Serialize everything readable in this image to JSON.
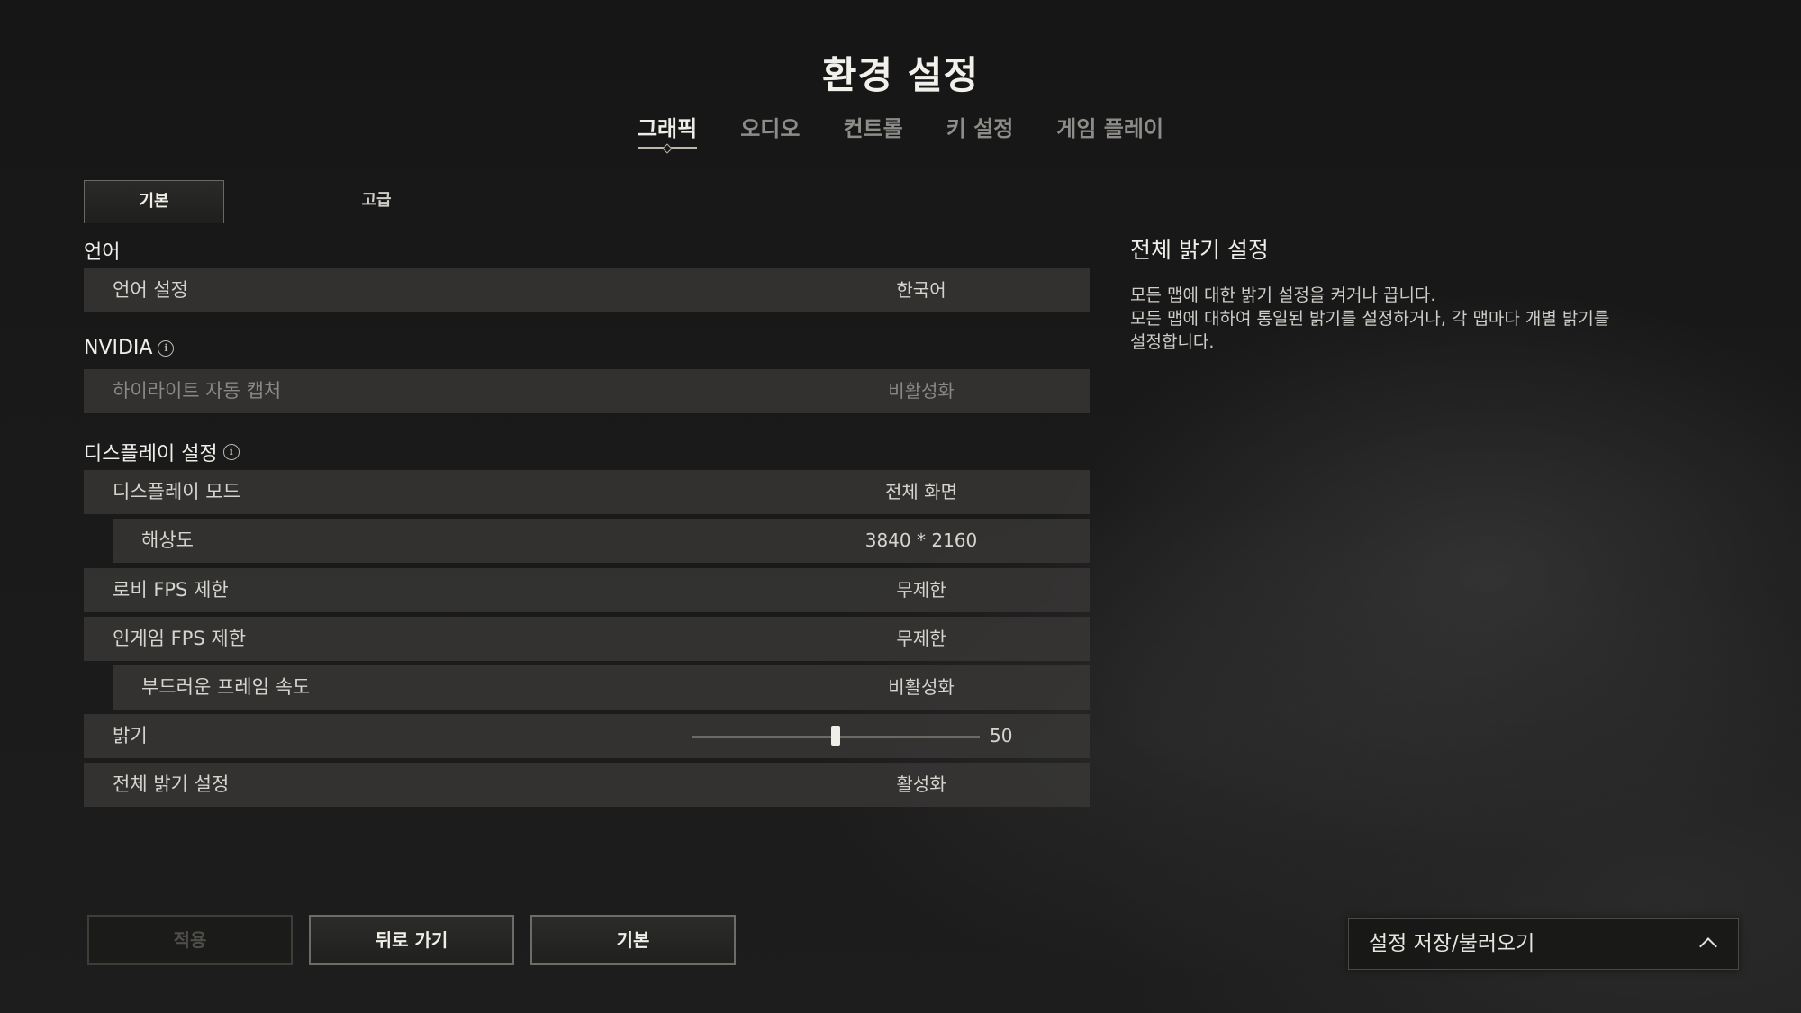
{
  "header": {
    "title": "환경 설정",
    "tabs": [
      {
        "label": "그래픽",
        "active": true
      },
      {
        "label": "오디오",
        "active": false
      },
      {
        "label": "컨트롤",
        "active": false
      },
      {
        "label": "키 설정",
        "active": false
      },
      {
        "label": "게임 플레이",
        "active": false
      }
    ]
  },
  "sub_tabs": {
    "basic": "기본",
    "advanced": "고급"
  },
  "sections": {
    "language": {
      "title": "언어",
      "rows": [
        {
          "label": "언어 설정",
          "value": "한국어"
        }
      ]
    },
    "nvidia": {
      "title": "NVIDIA",
      "rows": [
        {
          "label": "하이라이트 자동 캡처",
          "value": "비활성화",
          "disabled": true
        }
      ]
    },
    "display": {
      "title": "디스플레이 설정",
      "rows": [
        {
          "label": "디스플레이 모드",
          "value": "전체 화면"
        },
        {
          "label": "해상도",
          "value": "3840 * 2160",
          "indent": true
        },
        {
          "label": "로비 FPS 제한",
          "value": "무제한"
        },
        {
          "label": "인게임 FPS 제한",
          "value": "무제한"
        },
        {
          "label": "부드러운 프레임 속도",
          "value": "비활성화",
          "indent": true
        },
        {
          "label": "밝기",
          "value": "50",
          "slider": {
            "min": 0,
            "max": 100,
            "value": 50
          }
        },
        {
          "label": "전체 밝기 설정",
          "value": "활성화"
        }
      ]
    }
  },
  "description": {
    "title": "전체 밝기 설정",
    "lines": [
      "모든 맵에 대한 밝기 설정을 켜거나 끕니다.",
      "모든 맵에 대하여 통일된 밝기를 설정하거나, 각 맵마다 개별 밝기를",
      "설정합니다."
    ]
  },
  "buttons": {
    "apply": "적용",
    "back": "뒤로 가기",
    "default": "기본"
  },
  "preset": {
    "label": "설정 저장/불러오기"
  },
  "colors": {
    "background": "#1a1a1a",
    "row_background": "#3a3937",
    "accent_line": "#bdb8a8",
    "text": "#d6d4cf",
    "disabled_text": "#8a8884"
  },
  "icons": {
    "info": "info-icon",
    "chevron": "chevron-up-icon"
  }
}
